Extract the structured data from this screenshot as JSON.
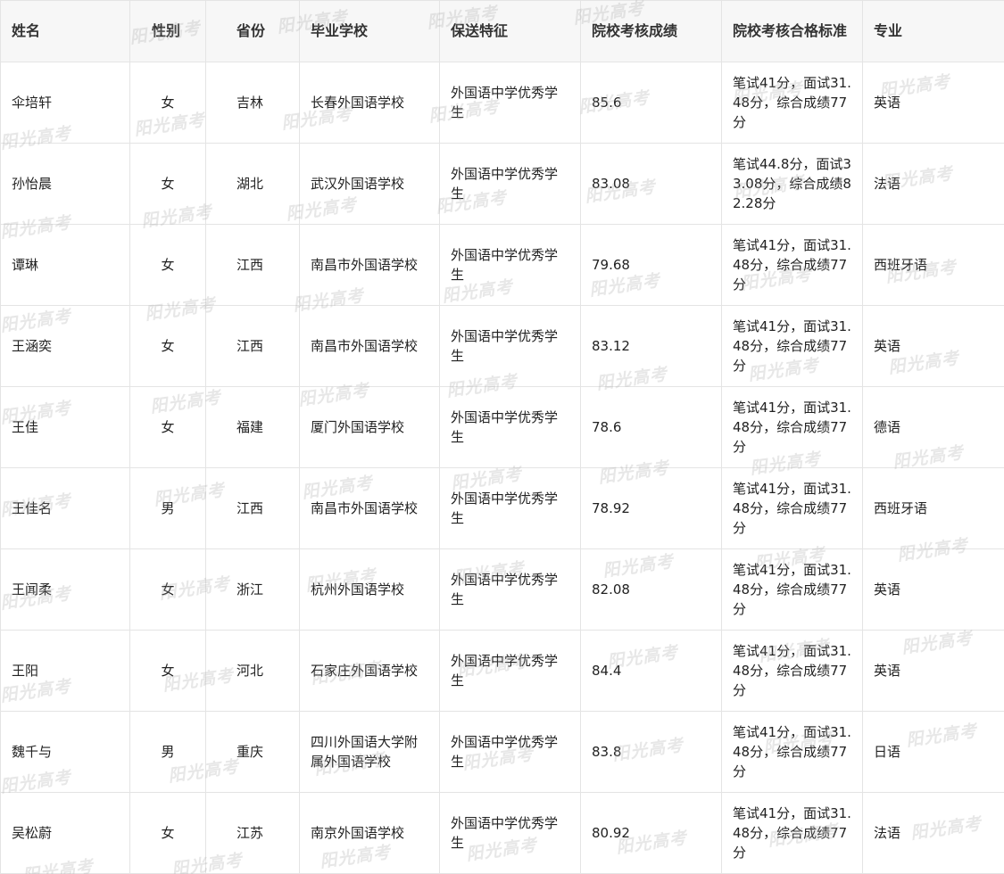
{
  "table": {
    "headers": [
      "姓名",
      "性别",
      "省份",
      "毕业学校",
      "保送特征",
      "院校考核成绩",
      "院校考核合格标准",
      "专业"
    ],
    "rows": [
      {
        "name": "伞培轩",
        "gender": "女",
        "province": "吉林",
        "school": "长春外国语学校",
        "feature": "外国语中学优秀学生",
        "score": "85.6",
        "standard": "笔试41分，面试31.48分，综合成绩77分",
        "major": "英语"
      },
      {
        "name": "孙怡晨",
        "gender": "女",
        "province": "湖北",
        "school": "武汉外国语学校",
        "feature": "外国语中学优秀学生",
        "score": "83.08",
        "standard": "笔试44.8分，面试33.08分，综合成绩82.28分",
        "major": "法语"
      },
      {
        "name": "谭琳",
        "gender": "女",
        "province": "江西",
        "school": "南昌市外国语学校",
        "feature": "外国语中学优秀学生",
        "score": "79.68",
        "standard": "笔试41分，面试31.48分，综合成绩77分",
        "major": "西班牙语"
      },
      {
        "name": "王涵奕",
        "gender": "女",
        "province": "江西",
        "school": "南昌市外国语学校",
        "feature": "外国语中学优秀学生",
        "score": "83.12",
        "standard": "笔试41分，面试31.48分，综合成绩77分",
        "major": "英语"
      },
      {
        "name": "王佳",
        "gender": "女",
        "province": "福建",
        "school": "厦门外国语学校",
        "feature": "外国语中学优秀学生",
        "score": "78.6",
        "standard": "笔试41分，面试31.48分，综合成绩77分",
        "major": "德语"
      },
      {
        "name": "王佳名",
        "gender": "男",
        "province": "江西",
        "school": "南昌市外国语学校",
        "feature": "外国语中学优秀学生",
        "score": "78.92",
        "standard": "笔试41分，面试31.48分，综合成绩77分",
        "major": "西班牙语"
      },
      {
        "name": "王闻柔",
        "gender": "女",
        "province": "浙江",
        "school": "杭州外国语学校",
        "feature": "外国语中学优秀学生",
        "score": "82.08",
        "standard": "笔试41分，面试31.48分，综合成绩77分",
        "major": "英语"
      },
      {
        "name": "王阳",
        "gender": "女",
        "province": "河北",
        "school": "石家庄外国语学校",
        "feature": "外国语中学优秀学生",
        "score": "84.4",
        "standard": "笔试41分，面试31.48分，综合成绩77分",
        "major": "英语"
      },
      {
        "name": "魏千与",
        "gender": "男",
        "province": "重庆",
        "school": "四川外国语大学附属外国语学校",
        "feature": "外国语中学优秀学生",
        "score": "83.8",
        "standard": "笔试41分，面试31.48分，综合成绩77分",
        "major": "日语"
      },
      {
        "name": "吴松蔚",
        "gender": "女",
        "province": "江苏",
        "school": "南京外国语学校",
        "feature": "外国语中学优秀学生",
        "score": "80.92",
        "standard": "笔试41分，面试31.48分，综合成绩77分",
        "major": "法语"
      }
    ]
  },
  "watermark": {
    "text": "阳光高考"
  }
}
